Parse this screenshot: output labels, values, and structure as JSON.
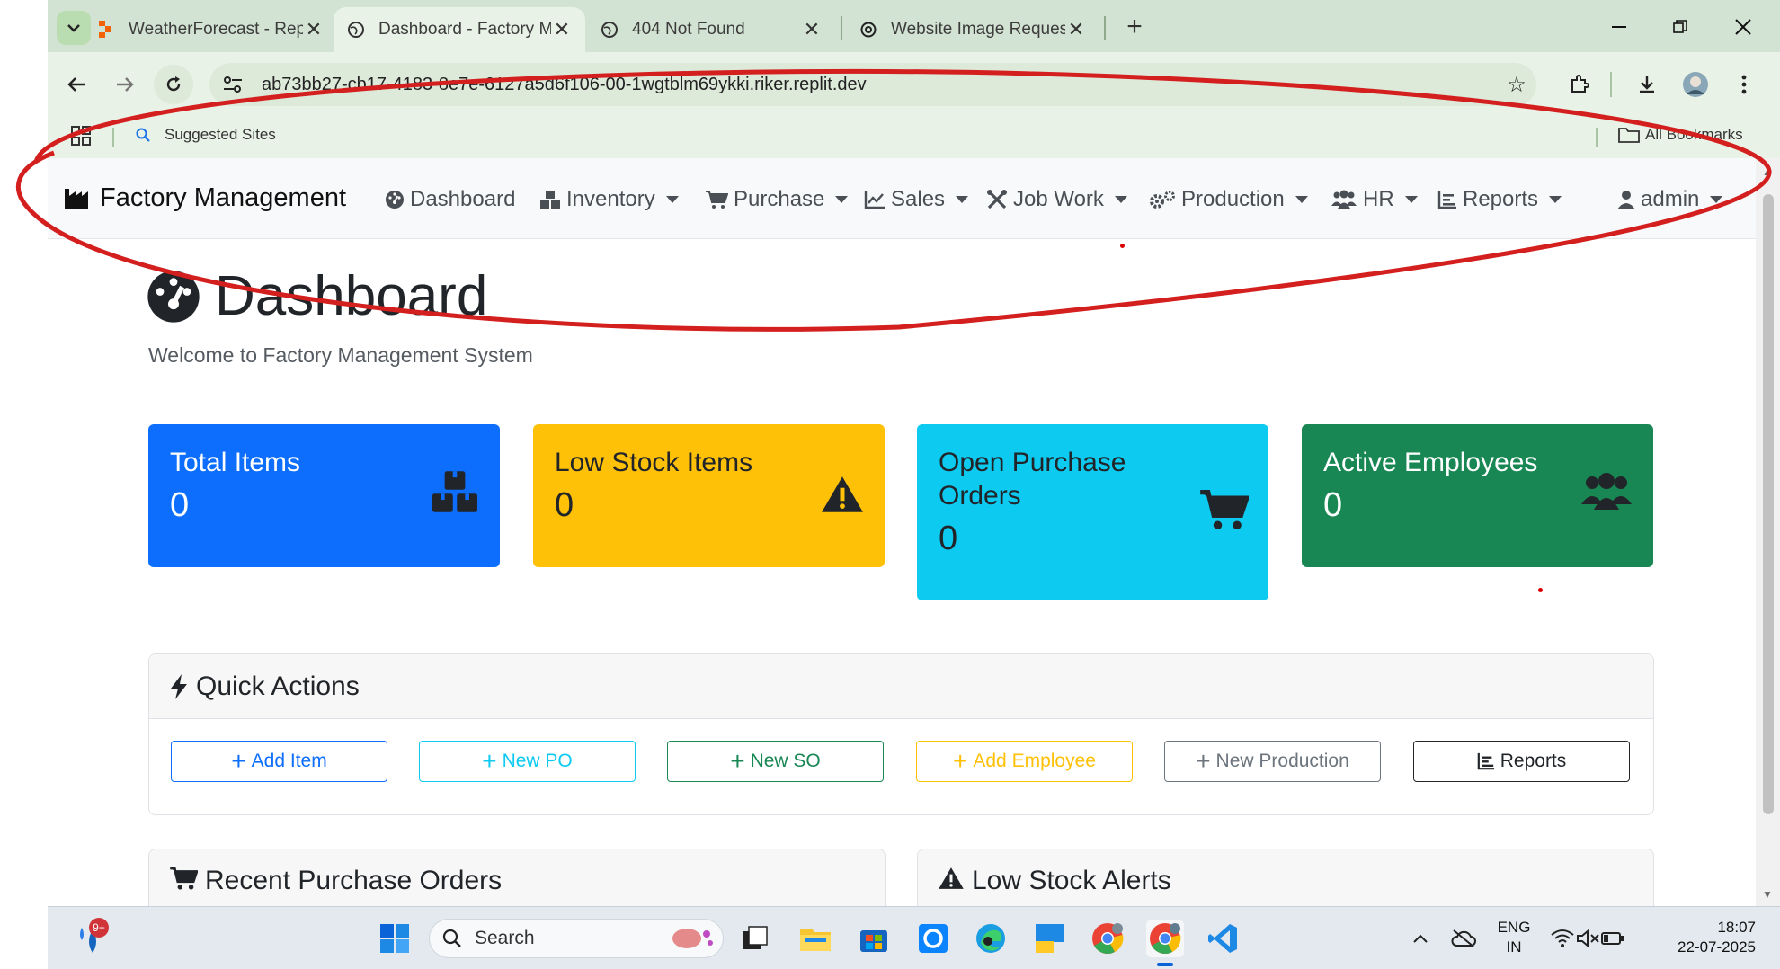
{
  "browser": {
    "tabs": [
      {
        "title": "WeatherForecast - Replit",
        "close": "✕"
      },
      {
        "title": "Dashboard - Factory Manageme",
        "close": "✕"
      },
      {
        "title": "404 Not Found",
        "close": "✕"
      },
      {
        "title": "Website Image Request",
        "close": "✕"
      }
    ],
    "new_tab": "+",
    "url": "ab73bb27-cb17-4183-8e7e-6127a5d6f106-00-1wgtblm69ykki.riker.replit.dev",
    "bookmarks": {
      "suggested": "Suggested Sites",
      "all": "All Bookmarks"
    }
  },
  "navbar": {
    "brand": "Factory Management",
    "items": [
      "Dashboard",
      "Inventory",
      "Purchase",
      "Sales",
      "Job Work",
      "Production",
      "HR",
      "Reports"
    ],
    "user": "admin"
  },
  "page": {
    "title": "Dashboard",
    "subtitle": "Welcome to Factory Management System"
  },
  "stats": [
    {
      "label": "Total Items",
      "value": "0",
      "color": "#0d6efd",
      "icon": "boxes-icon"
    },
    {
      "label": "Low Stock Items",
      "value": "0",
      "color": "#ffc107",
      "icon": "warning-icon"
    },
    {
      "label": "Open Purchase Orders",
      "value": "0",
      "color": "#0dcaf0",
      "icon": "cart-icon"
    },
    {
      "label": "Active Employees",
      "value": "0",
      "color": "#198754",
      "icon": "users-icon"
    }
  ],
  "quick_actions": {
    "title": "Quick Actions",
    "buttons": [
      "Add Item",
      "New PO",
      "New SO",
      "Add Employee",
      "New Production",
      "Reports"
    ]
  },
  "sections": {
    "recent_po": "Recent Purchase Orders",
    "low_stock": "Low Stock Alerts"
  },
  "taskbar": {
    "badge": "9+",
    "search": "Search",
    "lang": "ENG",
    "region": "IN",
    "time": "18:07",
    "date": "22-07-2025"
  }
}
